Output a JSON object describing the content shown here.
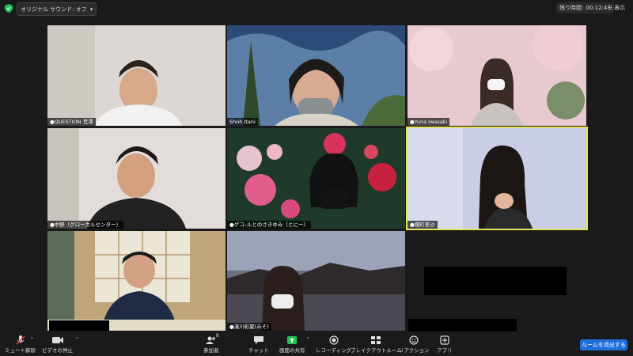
{
  "topbar": {
    "audio_label": "オリジナル サウンド: オフ",
    "timer_label": "残り時間:",
    "timer_value": "00:12:43",
    "view_label": "表示"
  },
  "participants": [
    {
      "name": "●QUESTION 荒澤"
    },
    {
      "name": "Shoh.Itani"
    },
    {
      "name": "●Yuna Iwasaki"
    },
    {
      "name": "●中野（グローカルセンター）"
    },
    {
      "name": "●ゲコ–ルとのさきゆみ（とにー）"
    },
    {
      "name": "●楳町美沙"
    },
    {
      "name": ""
    },
    {
      "name": "●濱川彩夏(みそ)"
    }
  ],
  "toolbar": {
    "mute": "ミュート解除",
    "video": "ビデオの停止",
    "participants": "参加者",
    "participants_count": "9",
    "chat": "チャット",
    "share": "画面の共有",
    "record": "レコーディング",
    "breakout": "ブレイクアウトルーム",
    "reactions": "リアクション",
    "apps": "アプリ",
    "leave": "ルームを退出する"
  },
  "colors": {
    "active_border": "#e6e35a",
    "share_green": "#23c552",
    "leave_blue": "#1f6fd9"
  }
}
